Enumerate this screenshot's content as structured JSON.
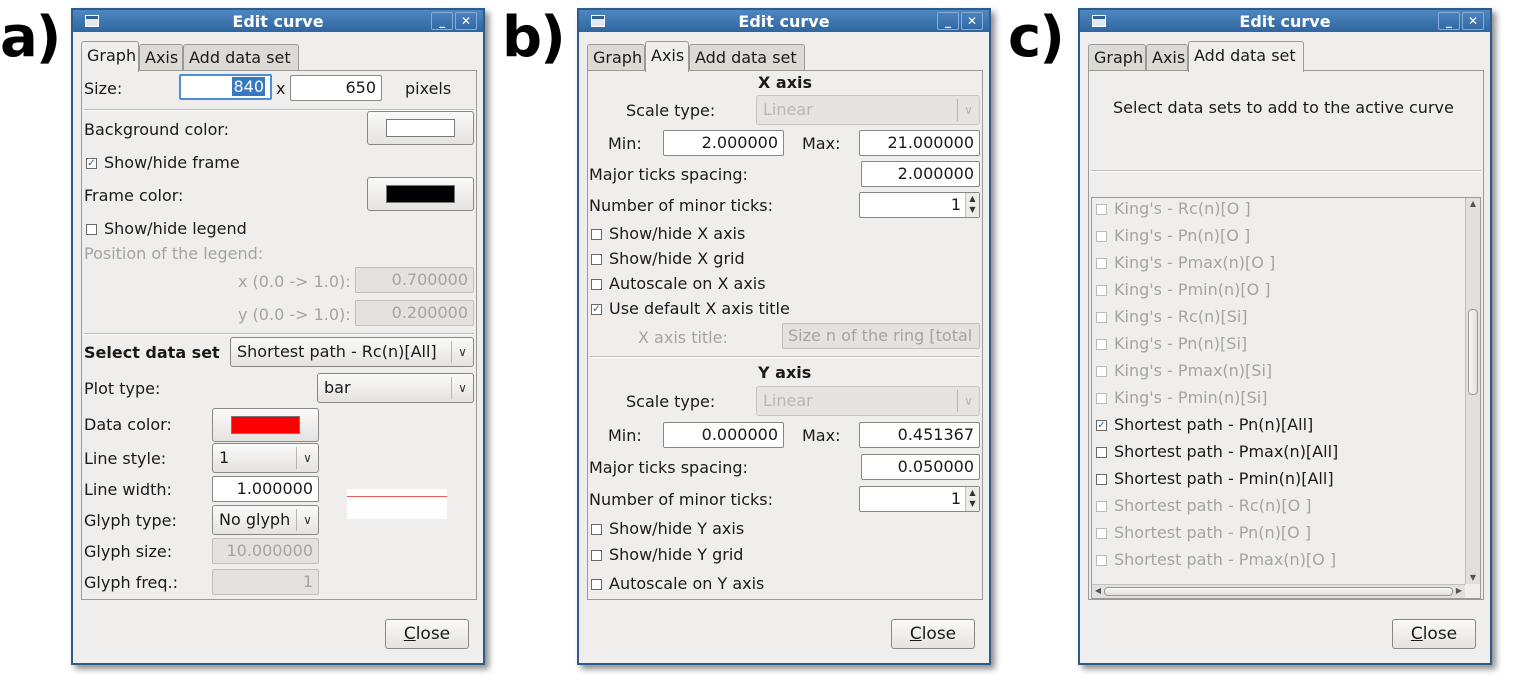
{
  "labels": {
    "a": "a)",
    "b": "b)",
    "c": "c)"
  },
  "window_title": "Edit curve",
  "tabs": [
    "Graph",
    "Axis",
    "Add data set"
  ],
  "close_label": "Close",
  "panel_a": {
    "size_label": "Size:",
    "width": "840",
    "times": "x",
    "height": "650",
    "pixels": "pixels",
    "background_color_label": "Background color:",
    "background_color": "#ffffff",
    "show_frame_label": "Show/hide frame",
    "show_frame": true,
    "frame_color_label": "Frame color:",
    "frame_color": "#000000",
    "show_legend_label": "Show/hide legend",
    "show_legend": false,
    "legend_position_label": "Position of the legend:",
    "legend_x_label": "x (0.0 -> 1.0):",
    "legend_x": "0.700000",
    "legend_y_label": "y (0.0 -> 1.0):",
    "legend_y": "0.200000",
    "select_data_set_label": "Select data set",
    "data_set": "Shortest path - Rc(n)[All]",
    "plot_type_label": "Plot type:",
    "plot_type": "bar",
    "data_color_label": "Data color:",
    "data_color": "#ff0000",
    "line_style_label": "Line style:",
    "line_style": "1",
    "line_width_label": "Line width:",
    "line_width": "1.000000",
    "glyph_type_label": "Glyph type:",
    "glyph_type": "No glyph",
    "glyph_size_label": "Glyph size:",
    "glyph_size": "10.000000",
    "glyph_freq_label": "Glyph freq.:",
    "glyph_freq": "1"
  },
  "panel_b": {
    "x_axis": {
      "heading": "X axis",
      "scale_type_label": "Scale type:",
      "scale_type": "Linear",
      "min_label": "Min:",
      "min": "2.000000",
      "max_label": "Max:",
      "max": "21.000000",
      "major_ticks_label": "Major ticks spacing:",
      "major_ticks": "2.000000",
      "minor_ticks_label": "Number of minor ticks:",
      "minor_ticks": "1",
      "show_axis_label": "Show/hide X axis",
      "show_axis": false,
      "show_grid_label": "Show/hide X grid",
      "show_grid": false,
      "autoscale_label": "Autoscale on X axis",
      "autoscale": false,
      "default_title_label": "Use default X axis title",
      "default_title": true,
      "title_label": "X axis title:",
      "title": "Size n of the ring [total"
    },
    "y_axis": {
      "heading": "Y axis",
      "scale_type_label": "Scale type:",
      "scale_type": "Linear",
      "min_label": "Min:",
      "min": "0.000000",
      "max_label": "Max:",
      "max": "0.451367",
      "major_ticks_label": "Major ticks spacing:",
      "major_ticks": "0.050000",
      "minor_ticks_label": "Number of minor ticks:",
      "minor_ticks": "1",
      "show_axis_label": "Show/hide Y axis",
      "show_axis": false,
      "show_grid_label": "Show/hide Y grid",
      "show_grid": false,
      "autoscale_label": "Autoscale on Y axis",
      "autoscale": false
    }
  },
  "panel_c": {
    "instruction": "Select data sets to add to the active curve",
    "data_sets": [
      {
        "label": "King's - Rc(n)[O ]",
        "checked": false,
        "enabled": false
      },
      {
        "label": "King's - Pn(n)[O ]",
        "checked": false,
        "enabled": false
      },
      {
        "label": "King's - Pmax(n)[O ]",
        "checked": false,
        "enabled": false
      },
      {
        "label": "King's - Pmin(n)[O ]",
        "checked": false,
        "enabled": false
      },
      {
        "label": "King's - Rc(n)[Si]",
        "checked": false,
        "enabled": false
      },
      {
        "label": "King's - Pn(n)[Si]",
        "checked": false,
        "enabled": false
      },
      {
        "label": "King's - Pmax(n)[Si]",
        "checked": false,
        "enabled": false
      },
      {
        "label": "King's - Pmin(n)[Si]",
        "checked": false,
        "enabled": false
      },
      {
        "label": "Shortest path - Pn(n)[All]",
        "checked": true,
        "enabled": true
      },
      {
        "label": "Shortest path - Pmax(n)[All]",
        "checked": false,
        "enabled": true
      },
      {
        "label": "Shortest path - Pmin(n)[All]",
        "checked": false,
        "enabled": true
      },
      {
        "label": "Shortest path - Rc(n)[O ]",
        "checked": false,
        "enabled": false
      },
      {
        "label": "Shortest path - Pn(n)[O ]",
        "checked": false,
        "enabled": false
      },
      {
        "label": "Shortest path - Pmax(n)[O ]",
        "checked": false,
        "enabled": false
      }
    ]
  }
}
